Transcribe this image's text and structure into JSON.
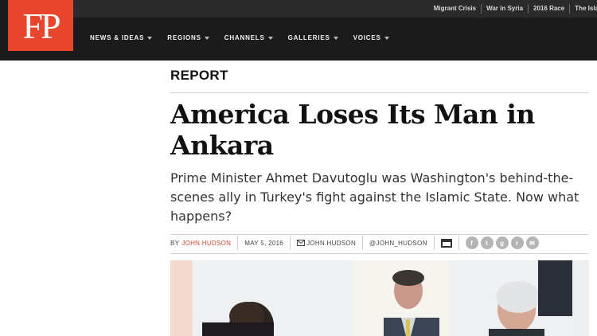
{
  "site": {
    "logo_text": "FP",
    "trending": [
      "Migrant Crisis",
      "War in Syria",
      "2016 Race",
      "The Isla"
    ]
  },
  "nav": {
    "items": [
      "NEWS & IDEAS",
      "REGIONS",
      "CHANNELS",
      "GALLERIES",
      "VOICES"
    ]
  },
  "article": {
    "section": "REPORT",
    "headline": "America Loses Its Man in Ankara",
    "dek": "Prime Minister Ahmet Davutoglu was Washington's behind-the-scenes ally in Turkey's fight against the Islamic State. Now what happens?",
    "byline_prefix": "BY",
    "author": "JOHN HUDSON",
    "date": "MAY 5, 2016",
    "email": "JOHN.HUDSON",
    "twitter": "@JOHN_HUDSON"
  },
  "colors": {
    "brand": "#e8462c",
    "topbar": "#1b1b1b",
    "author_link": "#d0492f"
  },
  "icons": {
    "print": "print-icon",
    "facebook": "facebook-icon",
    "twitter": "twitter-icon",
    "google_plus": "google-plus-icon",
    "reddit": "reddit-icon",
    "email_share": "email-share-icon"
  }
}
